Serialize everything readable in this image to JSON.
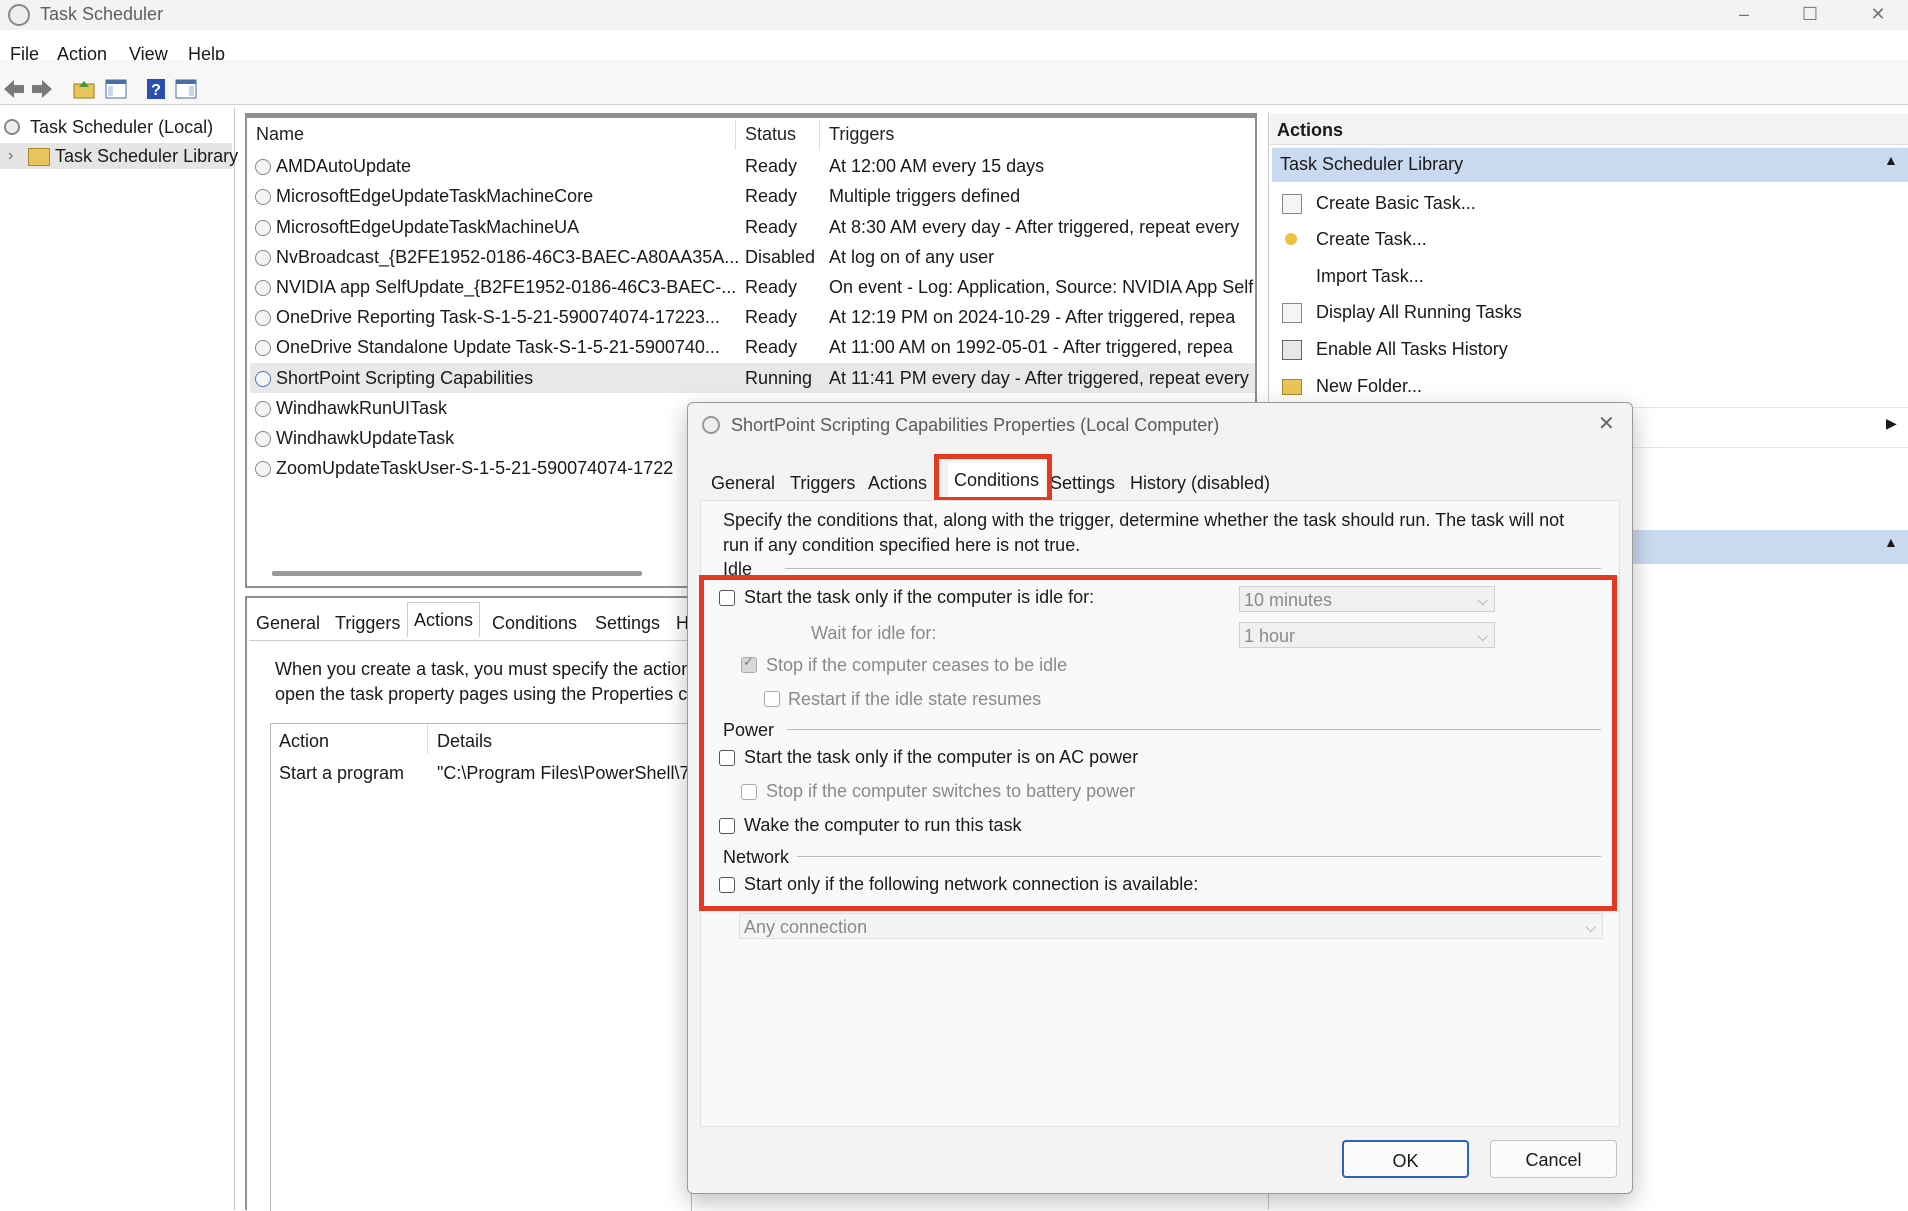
{
  "window": {
    "title": "Task Scheduler",
    "minimize": "–",
    "maximize": "☐",
    "close": "✕"
  },
  "menu": [
    "File",
    "Action",
    "View",
    "Help"
  ],
  "tree": {
    "root": "Task Scheduler (Local)",
    "library": "Task Scheduler Library"
  },
  "task_list": {
    "columns": [
      "Name",
      "Status",
      "Triggers"
    ],
    "rows": [
      {
        "name": "AMDAutoUpdate",
        "status": "Ready",
        "triggers": "At 12:00 AM every 15 days"
      },
      {
        "name": "MicrosoftEdgeUpdateTaskMachineCore",
        "status": "Ready",
        "triggers": "Multiple triggers defined"
      },
      {
        "name": "MicrosoftEdgeUpdateTaskMachineUA",
        "status": "Ready",
        "triggers": "At 8:30 AM every day - After triggered, repeat every"
      },
      {
        "name": "NvBroadcast_{B2FE1952-0186-46C3-BAEC-A80AA35A...",
        "status": "Disabled",
        "triggers": "At log on of any user"
      },
      {
        "name": "NVIDIA app SelfUpdate_{B2FE1952-0186-46C3-BAEC-...",
        "status": "Ready",
        "triggers": "On event - Log: Application, Source: NVIDIA App Self"
      },
      {
        "name": "OneDrive Reporting Task-S-1-5-21-590074074-17223...",
        "status": "Ready",
        "triggers": "At 12:19 PM on 2024-10-29 - After triggered, repea"
      },
      {
        "name": "OneDrive Standalone Update Task-S-1-5-21-5900740...",
        "status": "Ready",
        "triggers": "At 11:00 AM on 1992-05-01 - After triggered, repea"
      },
      {
        "name": "ShortPoint Scripting Capabilities",
        "status": "Running",
        "triggers": "At 11:41 PM every day - After triggered, repeat every"
      },
      {
        "name": "WindhawkRunUITask",
        "status": "",
        "triggers": ""
      },
      {
        "name": "WindhawkUpdateTask",
        "status": "",
        "triggers": ""
      },
      {
        "name": "ZoomUpdateTaskUser-S-1-5-21-590074074-1722",
        "status": "",
        "triggers": ""
      }
    ]
  },
  "detail": {
    "tabs": [
      "General",
      "Triggers",
      "Actions",
      "Conditions",
      "Settings",
      "H"
    ],
    "text1": "When you create a task, you must specify the action",
    "text2": "open the task property pages using the Properties c",
    "columns": [
      "Action",
      "Details"
    ],
    "row": {
      "action": "Start a program",
      "details": "\"C:\\Program Files\\PowerShell\\7\\"
    }
  },
  "actions_pane": {
    "header": "Actions",
    "section": "Task Scheduler Library",
    "items": [
      "Create Basic Task...",
      "Create Task...",
      "Import Task...",
      "Display All Running Tasks",
      "Enable All Tasks History",
      "New Folder..."
    ]
  },
  "dialog": {
    "title": "ShortPoint Scripting Capabilities Properties (Local Computer)",
    "tabs": [
      "General",
      "Triggers",
      "Actions",
      "Conditions",
      "Settings",
      "History (disabled)"
    ],
    "active_tab": "Conditions",
    "intro1": "Specify the conditions that, along with the trigger, determine whether the task should run.  The task will not",
    "intro2": "run  if any condition specified here is not true.",
    "idle_group": "Idle",
    "idle_start": "Start the task only if the computer is idle for:",
    "idle_for_value": "10 minutes",
    "wait_label": "Wait for idle for:",
    "wait_value": "1 hour",
    "stop_idle": "Stop if the computer ceases to be idle",
    "restart_idle": "Restart if the idle state resumes",
    "power_group": "Power",
    "ac_power": "Start the task only if the computer is on AC power",
    "battery": "Stop if the computer switches to battery power",
    "wake": "Wake the computer to run this task",
    "network_group": "Network",
    "network_start": "Start only if the following network connection is available:",
    "network_value": "Any connection",
    "ok": "OK",
    "cancel": "Cancel"
  },
  "colors": {
    "highlight": "#e53a22",
    "section_header": "#c9d9f0",
    "selected_row": "#e8e8e8"
  }
}
